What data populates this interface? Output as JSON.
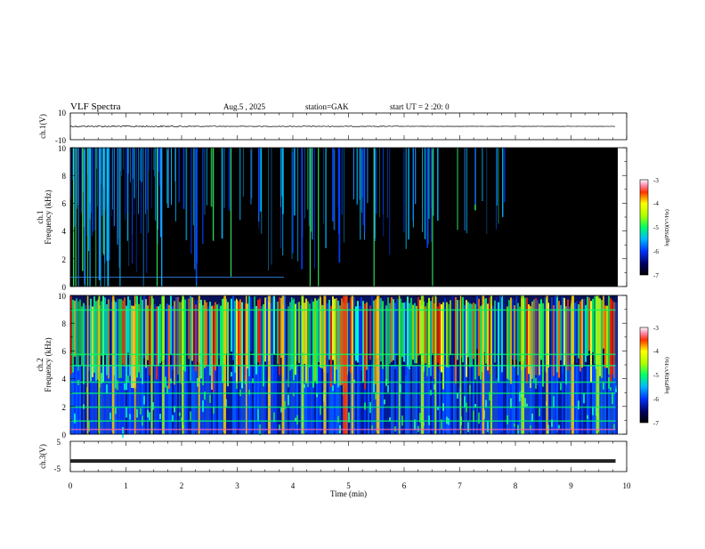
{
  "header": {
    "title": "VLF  Spectra",
    "date": "Aug.5  , 2025",
    "station": "station=GAK",
    "start_ut": "start  UT  =    2  :20: 0"
  },
  "chart_data": [
    {
      "id": "ch1-waveform",
      "type": "line",
      "ylabel": "ch.1(V)",
      "ylim": [
        -10,
        10
      ],
      "yticks": [
        "10",
        "-10"
      ],
      "series": [
        {
          "values_description_level": 0
        }
      ]
    },
    {
      "id": "ch1-spectrogram",
      "type": "heatmap",
      "ylabel": "ch.1\nFrequency  (kHz)",
      "ylabel_line1": "ch.1",
      "ylabel_line2": "Frequency  (kHz)",
      "ylim": [
        0,
        10
      ],
      "yticks": [
        "0",
        "2",
        "4",
        "6",
        "8",
        "10"
      ],
      "data_end_min": 7.8,
      "colorbar": {
        "label": "log(PSD)(V²/Hz)",
        "range": [
          -7,
          -3
        ],
        "ticks": [
          "-3",
          "-4",
          "-5",
          "-6",
          "-7"
        ]
      }
    },
    {
      "id": "ch2-spectrogram",
      "type": "heatmap",
      "ylabel_line1": "ch.2",
      "ylabel_line2": "Frequency  (kHz)",
      "ylim": [
        0,
        10
      ],
      "yticks": [
        "0",
        "2",
        "4",
        "6",
        "8",
        "10"
      ],
      "colorbar": {
        "label": "log(PSD)(V²/Hz)",
        "range": [
          -7,
          -3
        ],
        "ticks": [
          "-3",
          "-4",
          "-5",
          "-6",
          "-7"
        ]
      }
    },
    {
      "id": "ch3-waveform",
      "type": "line",
      "ylabel": "ch.3(V)",
      "ylim": [
        -5,
        5
      ],
      "yticks": [
        "5",
        "-5"
      ],
      "level": -1.5
    }
  ],
  "x_axis": {
    "xlabel": "Time  (min)",
    "xlim": [
      0,
      10
    ],
    "ticks": [
      "0",
      "1",
      "2",
      "3",
      "4",
      "5",
      "6",
      "7",
      "8",
      "9",
      "10"
    ],
    "data_end_min": 9.8
  }
}
